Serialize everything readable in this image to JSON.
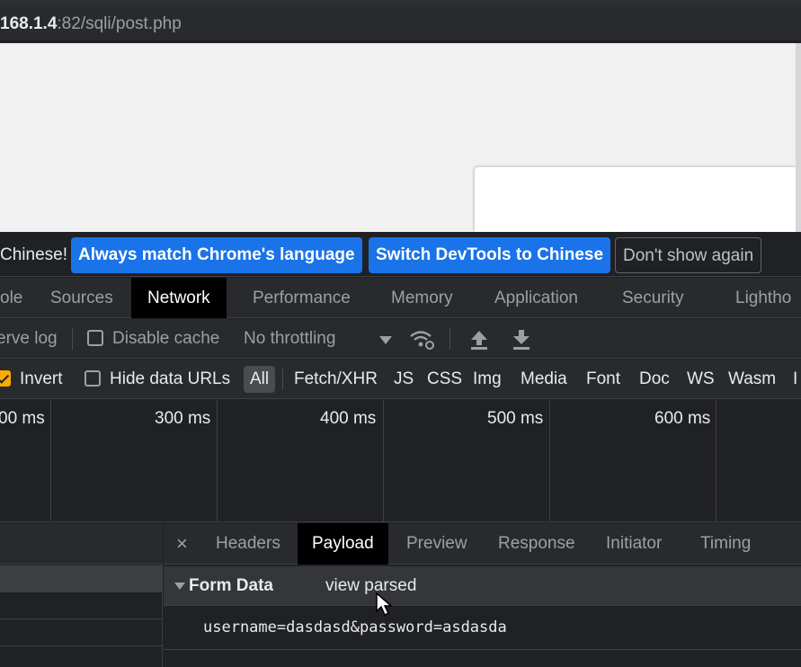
{
  "browser": {
    "url_host": "168.1.4",
    "url_rest": ":82/sqli/post.php"
  },
  "infobar": {
    "message": "Chinese!",
    "buttons": {
      "match_language": "Always match Chrome's language",
      "switch_language": "Switch DevTools to Chinese",
      "dont_show": "Don't show again"
    }
  },
  "tabs": [
    {
      "label": "ole"
    },
    {
      "label": "Sources"
    },
    {
      "label": "Network",
      "active": true
    },
    {
      "label": "Performance"
    },
    {
      "label": "Memory"
    },
    {
      "label": "Application"
    },
    {
      "label": "Security"
    },
    {
      "label": "Lightho"
    }
  ],
  "toolbar": {
    "preserve_log": "erve log",
    "disable_cache": "Disable cache",
    "throttling": "No throttling",
    "icons": [
      "dropdown-icon",
      "wifi-gear-icon",
      "upload-icon",
      "download-icon"
    ]
  },
  "filters": {
    "invert": "Invert",
    "invert_checked": true,
    "hide_data_urls": "Hide data URLs",
    "types": [
      "All",
      "Fetch/XHR",
      "JS",
      "CSS",
      "Img",
      "Media",
      "Font",
      "Doc",
      "WS",
      "Wasm",
      "I"
    ],
    "selected": "All"
  },
  "timeline": {
    "ticks": [
      "00 ms",
      "300 ms",
      "400 ms",
      "500 ms",
      "600 ms"
    ]
  },
  "details": {
    "close": "×",
    "tabs": [
      "Headers",
      "Payload",
      "Preview",
      "Response",
      "Initiator",
      "Timing"
    ],
    "active_tab": "Payload",
    "section_title": "Form Data",
    "view_parsed": "view parsed",
    "payload": "username=dasdasd&password=asdasda"
  },
  "colors": {
    "primary_button": "#1a73e8",
    "checkbox_accent": "#f9ab00",
    "active_tab_bg": "#000000"
  }
}
